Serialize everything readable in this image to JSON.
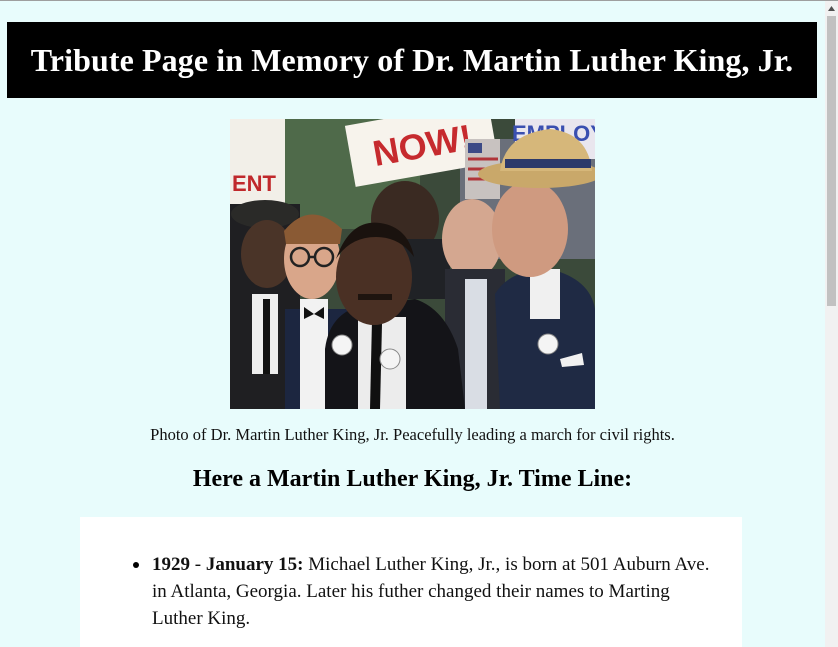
{
  "header": {
    "title": "Tribute Page in Memory of Dr. Martin Luther King, Jr."
  },
  "photo": {
    "caption": "Photo of Dr. Martin Luther King, Jr. Peacefully leading a march for civil rights.",
    "sign_text_left": "ENT",
    "sign_text_center": "NOW!",
    "sign_text_right": "EMPLOY"
  },
  "timeline": {
    "title": "Here a Martin Luther King, Jr. Time Line:",
    "items": [
      {
        "year": "1929",
        "separator": " - ",
        "date": "January 15:",
        "text": " Michael Luther King, Jr., is born at 501 Auburn Ave. in Atlanta, Georgia. Later his futher changed their names to Marting Luther King."
      }
    ]
  },
  "colors": {
    "page_background": "#e8fcfc",
    "header_background": "#000000",
    "header_text": "#ffffff",
    "timeline_box": "#ffffff"
  }
}
